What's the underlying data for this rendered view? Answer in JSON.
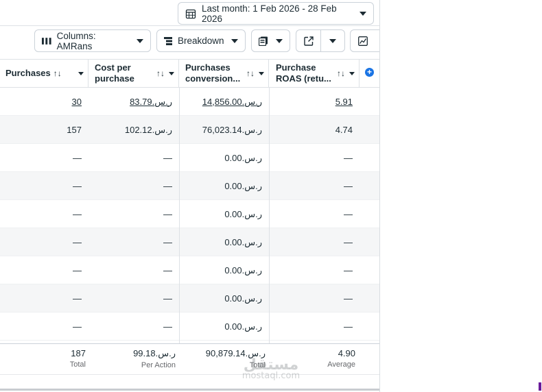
{
  "toolbar": {
    "date_range_label": "Last month: 1 Feb 2026 - 28 Feb 2026",
    "columns_label": "Columns: AMRans",
    "breakdown_label": "Breakdown"
  },
  "table": {
    "headers": [
      {
        "line1": "Purchases",
        "line2": ""
      },
      {
        "line1": "Cost per",
        "line2": "purchase"
      },
      {
        "line1": "Purchases",
        "line2": "conversion..."
      },
      {
        "line1": "Purchase",
        "line2": "ROAS (retu..."
      }
    ],
    "sort_glyph": "↑↓",
    "rows": [
      {
        "purchases": "30",
        "cost": "83.79.ر.س",
        "conversion": "14,856.00.ر.س",
        "roas": "5.91",
        "linked": true
      },
      {
        "purchases": "157",
        "cost": "102.12.ر.س",
        "conversion": "76,023.14.ر.س",
        "roas": "4.74",
        "linked": false
      },
      {
        "purchases": "—",
        "cost": "—",
        "conversion": "0.00.ر.س",
        "roas": "—",
        "linked": false
      },
      {
        "purchases": "—",
        "cost": "—",
        "conversion": "0.00.ر.س",
        "roas": "—",
        "linked": false
      },
      {
        "purchases": "—",
        "cost": "—",
        "conversion": "0.00.ر.س",
        "roas": "—",
        "linked": false
      },
      {
        "purchases": "—",
        "cost": "—",
        "conversion": "0.00.ر.س",
        "roas": "—",
        "linked": false
      },
      {
        "purchases": "—",
        "cost": "—",
        "conversion": "0.00.ر.س",
        "roas": "—",
        "linked": false
      },
      {
        "purchases": "—",
        "cost": "—",
        "conversion": "0.00.ر.س",
        "roas": "—",
        "linked": false
      },
      {
        "purchases": "—",
        "cost": "—",
        "conversion": "0.00.ر.س",
        "roas": "—",
        "linked": false
      }
    ],
    "totals": {
      "purchases": {
        "value": "187",
        "sub": "Total"
      },
      "cost": {
        "value": "99.18.ر.س",
        "sub": "Per Action"
      },
      "conversion": {
        "value": "90,879.14.ر.س",
        "sub": "Total"
      },
      "roas": {
        "value": "4.90",
        "sub": "Average"
      }
    }
  },
  "watermark": {
    "arabic": "مستقل",
    "latin": "mostaql.com"
  },
  "colors": {
    "accent": "#1a74e4",
    "border": "#cbd2d9",
    "alt_row": "#f5f6f7",
    "text": "#1c2b33"
  }
}
